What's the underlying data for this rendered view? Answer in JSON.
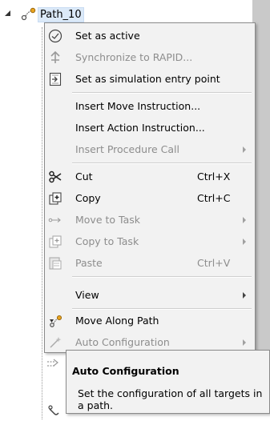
{
  "tree": {
    "node_label": "Path_10"
  },
  "menu": {
    "items": [
      {
        "label": "Set as active",
        "icon": "checkmark-circle-icon",
        "shortcut": "",
        "submenu": false,
        "enabled": true
      },
      {
        "label": "Synchronize to RAPID...",
        "icon": "synchronize-icon",
        "shortcut": "",
        "submenu": false,
        "enabled": false
      },
      {
        "label": "Set as simulation entry point",
        "icon": "entry-point-icon",
        "shortcut": "",
        "submenu": false,
        "enabled": true
      },
      {
        "label": "Insert Move Instruction...",
        "icon": "",
        "shortcut": "",
        "submenu": false,
        "enabled": true
      },
      {
        "label": "Insert Action Instruction...",
        "icon": "",
        "shortcut": "",
        "submenu": false,
        "enabled": true
      },
      {
        "label": "Insert Procedure Call",
        "icon": "",
        "shortcut": "",
        "submenu": true,
        "enabled": false
      },
      {
        "label": "Cut",
        "icon": "scissors-icon",
        "shortcut": "Ctrl+X",
        "submenu": false,
        "enabled": true
      },
      {
        "label": "Copy",
        "icon": "copy-icon",
        "shortcut": "Ctrl+C",
        "submenu": false,
        "enabled": true
      },
      {
        "label": "Move to Task",
        "icon": "move-to-task-icon",
        "shortcut": "",
        "submenu": true,
        "enabled": false
      },
      {
        "label": "Copy to Task",
        "icon": "copy-to-task-icon",
        "shortcut": "",
        "submenu": true,
        "enabled": false
      },
      {
        "label": "Paste",
        "icon": "paste-icon",
        "shortcut": "Ctrl+V",
        "submenu": false,
        "enabled": false
      },
      {
        "label": "View",
        "icon": "",
        "shortcut": "",
        "submenu": true,
        "enabled": true
      },
      {
        "label": "Move Along Path",
        "icon": "move-along-path-icon",
        "shortcut": "",
        "submenu": false,
        "enabled": true
      },
      {
        "label": "Auto Configuration",
        "icon": "auto-configuration-icon",
        "shortcut": "",
        "submenu": true,
        "enabled": false
      }
    ]
  },
  "tooltip": {
    "title": "Auto Configuration",
    "body": "Set the configuration of all targets in a path."
  }
}
